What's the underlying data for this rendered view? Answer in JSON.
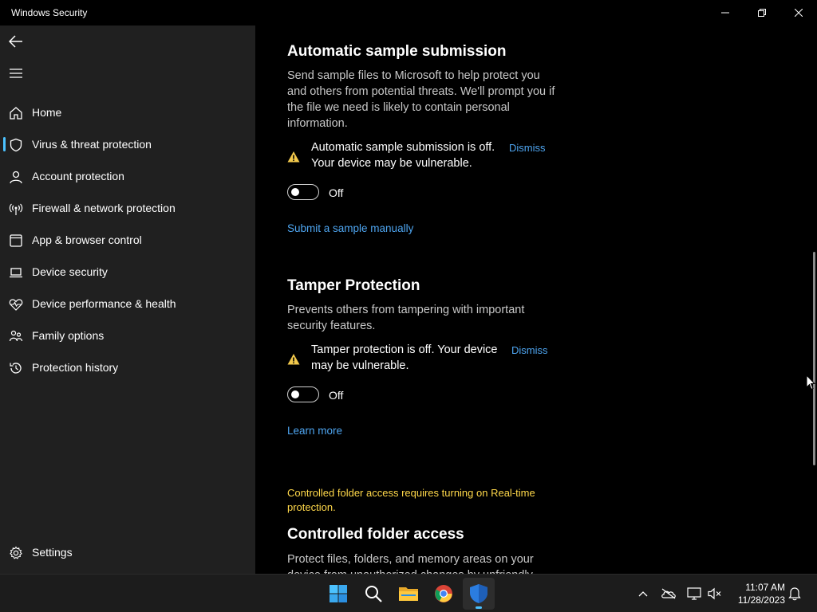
{
  "window": {
    "title": "Windows Security",
    "controls": [
      "minimize",
      "restore",
      "close"
    ]
  },
  "sidebar": {
    "items": [
      {
        "label": "Home",
        "icon": "home-icon"
      },
      {
        "label": "Virus & threat protection",
        "icon": "shield-icon",
        "selected": true
      },
      {
        "label": "Account protection",
        "icon": "person-icon"
      },
      {
        "label": "Firewall & network protection",
        "icon": "antenna-icon"
      },
      {
        "label": "App & browser control",
        "icon": "browser-window-icon"
      },
      {
        "label": "Device security",
        "icon": "laptop-icon"
      },
      {
        "label": "Device performance & health",
        "icon": "heart-pulse-icon"
      },
      {
        "label": "Family options",
        "icon": "family-icon"
      },
      {
        "label": "Protection history",
        "icon": "history-icon"
      }
    ],
    "settings_label": "Settings"
  },
  "sections": {
    "sample_submission": {
      "title": "Automatic sample submission",
      "description": "Send sample files to Microsoft to help protect you and others from potential threats. We'll prompt you if the file we need is likely to contain personal information.",
      "warning": "Automatic sample submission is off. Your device may be vulnerable.",
      "dismiss": "Dismiss",
      "toggle_state": "Off",
      "link": "Submit a sample manually"
    },
    "tamper_protection": {
      "title": "Tamper Protection",
      "description": "Prevents others from tampering with important security features.",
      "warning": "Tamper protection is off. Your device may be vulnerable.",
      "dismiss": "Dismiss",
      "toggle_state": "Off",
      "link": "Learn more"
    },
    "controlled_folder": {
      "note": "Controlled folder access requires turning on Real-time protection.",
      "title": "Controlled folder access",
      "description": "Protect files, folders, and memory areas on your device from unauthorized changes by unfriendly"
    }
  },
  "taskbar": {
    "apps": [
      "windows-start-icon",
      "search-icon",
      "file-explorer-icon",
      "chrome-icon",
      "windows-security-icon"
    ],
    "tray": [
      "chevron-up-icon",
      "onedrive-icon",
      "network-icon",
      "volume-muted-icon",
      "notification-bell-icon"
    ],
    "time": "11:07 AM",
    "date": "11/28/2023"
  },
  "colors": {
    "accent": "#4cc2ff",
    "link": "#4ea5f0",
    "warning": "#ffd84a",
    "sidebar_bg": "#202020",
    "content_bg": "#000000"
  }
}
